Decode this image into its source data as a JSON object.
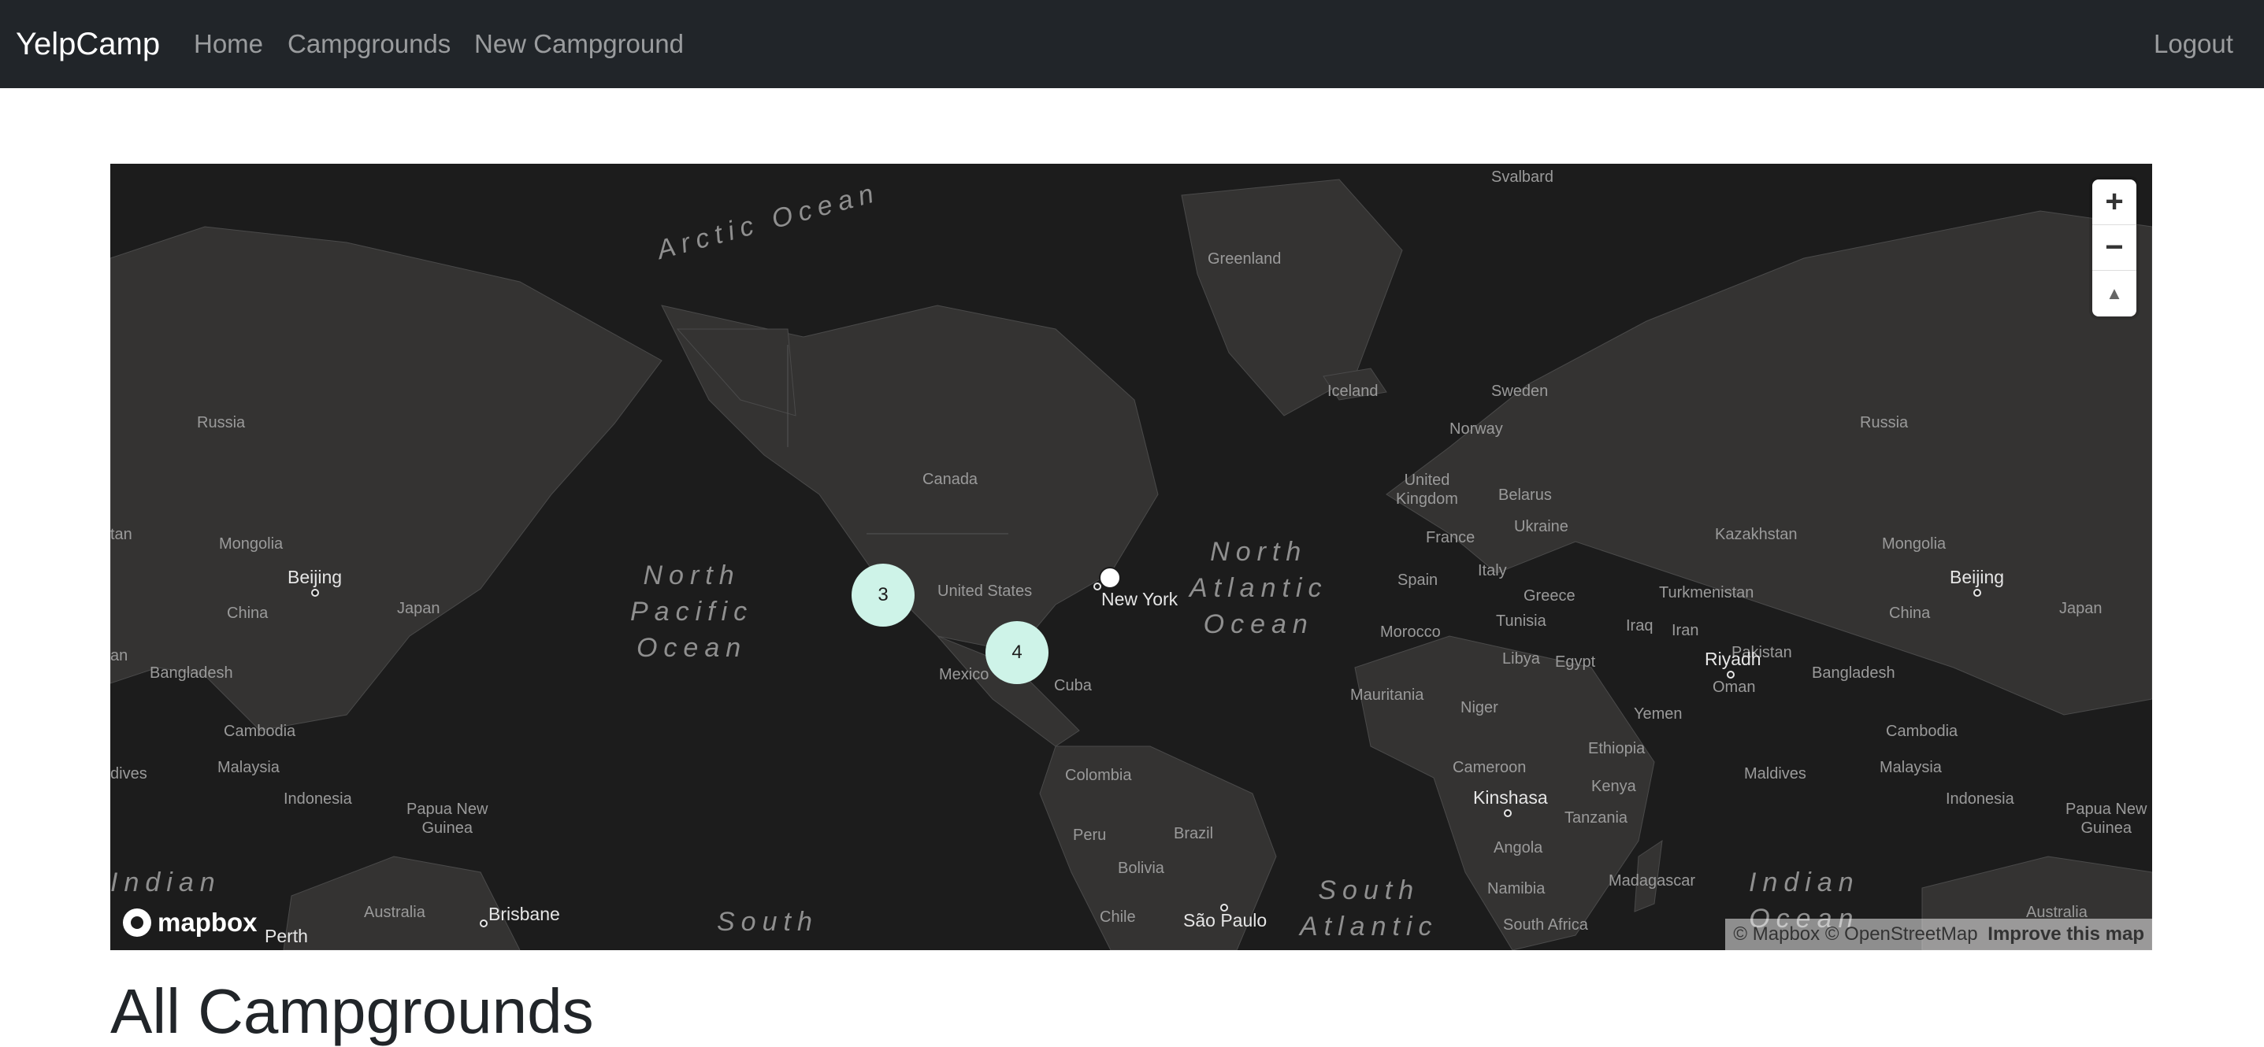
{
  "navbar": {
    "brand": "YelpCamp",
    "links": [
      "Home",
      "Campgrounds",
      "New Campground"
    ],
    "logout": "Logout"
  },
  "map": {
    "oceans": {
      "arctic": "Arctic Ocean",
      "north_pacific": "North\nPacific\nOcean",
      "north_atlantic": "North\nAtlantic\nOcean",
      "south_atlantic": "South\nAtlantic",
      "south_pacific": "South",
      "indian_left": "Indian",
      "indian_right": "Indian\nOcean"
    },
    "countries": {
      "svalbard": "Svalbard",
      "greenland": "Greenland",
      "iceland": "Iceland",
      "russia_left": "Russia",
      "russia_right": "Russia",
      "canada": "Canada",
      "united_states": "United States",
      "mexico": "Mexico",
      "cuba": "Cuba",
      "colombia": "Colombia",
      "peru": "Peru",
      "brazil": "Brazil",
      "bolivia": "Bolivia",
      "chile": "Chile",
      "sweden": "Sweden",
      "norway": "Norway",
      "united_kingdom": "United\nKingdom",
      "belarus": "Belarus",
      "ukraine": "Ukraine",
      "france": "France",
      "spain": "Spain",
      "italy": "Italy",
      "greece": "Greece",
      "turkmenistan": "Turkmenistan",
      "kazakhstan": "Kazakhstan",
      "mongolia_left": "Mongolia",
      "mongolia_right": "Mongolia",
      "china_left": "China",
      "china_right": "China",
      "japan_left": "Japan",
      "japan_right": "Japan",
      "bangladesh_left": "Bangladesh",
      "bangladesh_right": "Bangladesh",
      "cambodia_left": "Cambodia",
      "cambodia_right": "Cambodia",
      "malaysia_left": "Malaysia",
      "malaysia_right": "Malaysia",
      "indonesia_left": "Indonesia",
      "indonesia_right": "Indonesia",
      "png_left": "Papua New\nGuinea",
      "png_right": "Papua New\nGuinea",
      "australia_left": "Australia",
      "australia_right": "Australia",
      "maldives_left": "dives",
      "maldives_right": "Maldives",
      "tan_left": "tan",
      "an_left": "an",
      "morocco": "Morocco",
      "tunisia": "Tunisia",
      "libya": "Libya",
      "egypt": "Egypt",
      "iraq": "Iraq",
      "iran": "Iran",
      "pakistan": "Pakistan",
      "oman": "Oman",
      "yemen": "Yemen",
      "mauritania": "Mauritania",
      "niger": "Niger",
      "ethiopia": "Ethiopia",
      "cameroon": "Cameroon",
      "kenya": "Kenya",
      "tanzania": "Tanzania",
      "angola": "Angola",
      "namibia": "Namibia",
      "madagascar": "Madagascar",
      "south_africa": "South Africa"
    },
    "cities": {
      "beijing_left": "Beijing",
      "beijing_right": "Beijing",
      "new_york": "New York",
      "riyadh": "Riyadh",
      "kinshasa": "Kinshasa",
      "brisbane": "Brisbane",
      "perth": "Perth",
      "sao_paulo": "São Paulo"
    },
    "clusters": [
      {
        "count": "3"
      },
      {
        "count": "4"
      }
    ],
    "controls": {
      "zoom_in": "+",
      "zoom_out": "−",
      "compass": "▲"
    },
    "logo": "mapbox",
    "attribution": "© Mapbox © OpenStreetMap",
    "improve": "Improve this map"
  },
  "page": {
    "heading": "All Campgrounds"
  },
  "colors": {
    "navbar_bg": "#212529",
    "map_bg": "#1c1c1c",
    "land": "#343332",
    "cluster": "#cef3e8"
  }
}
